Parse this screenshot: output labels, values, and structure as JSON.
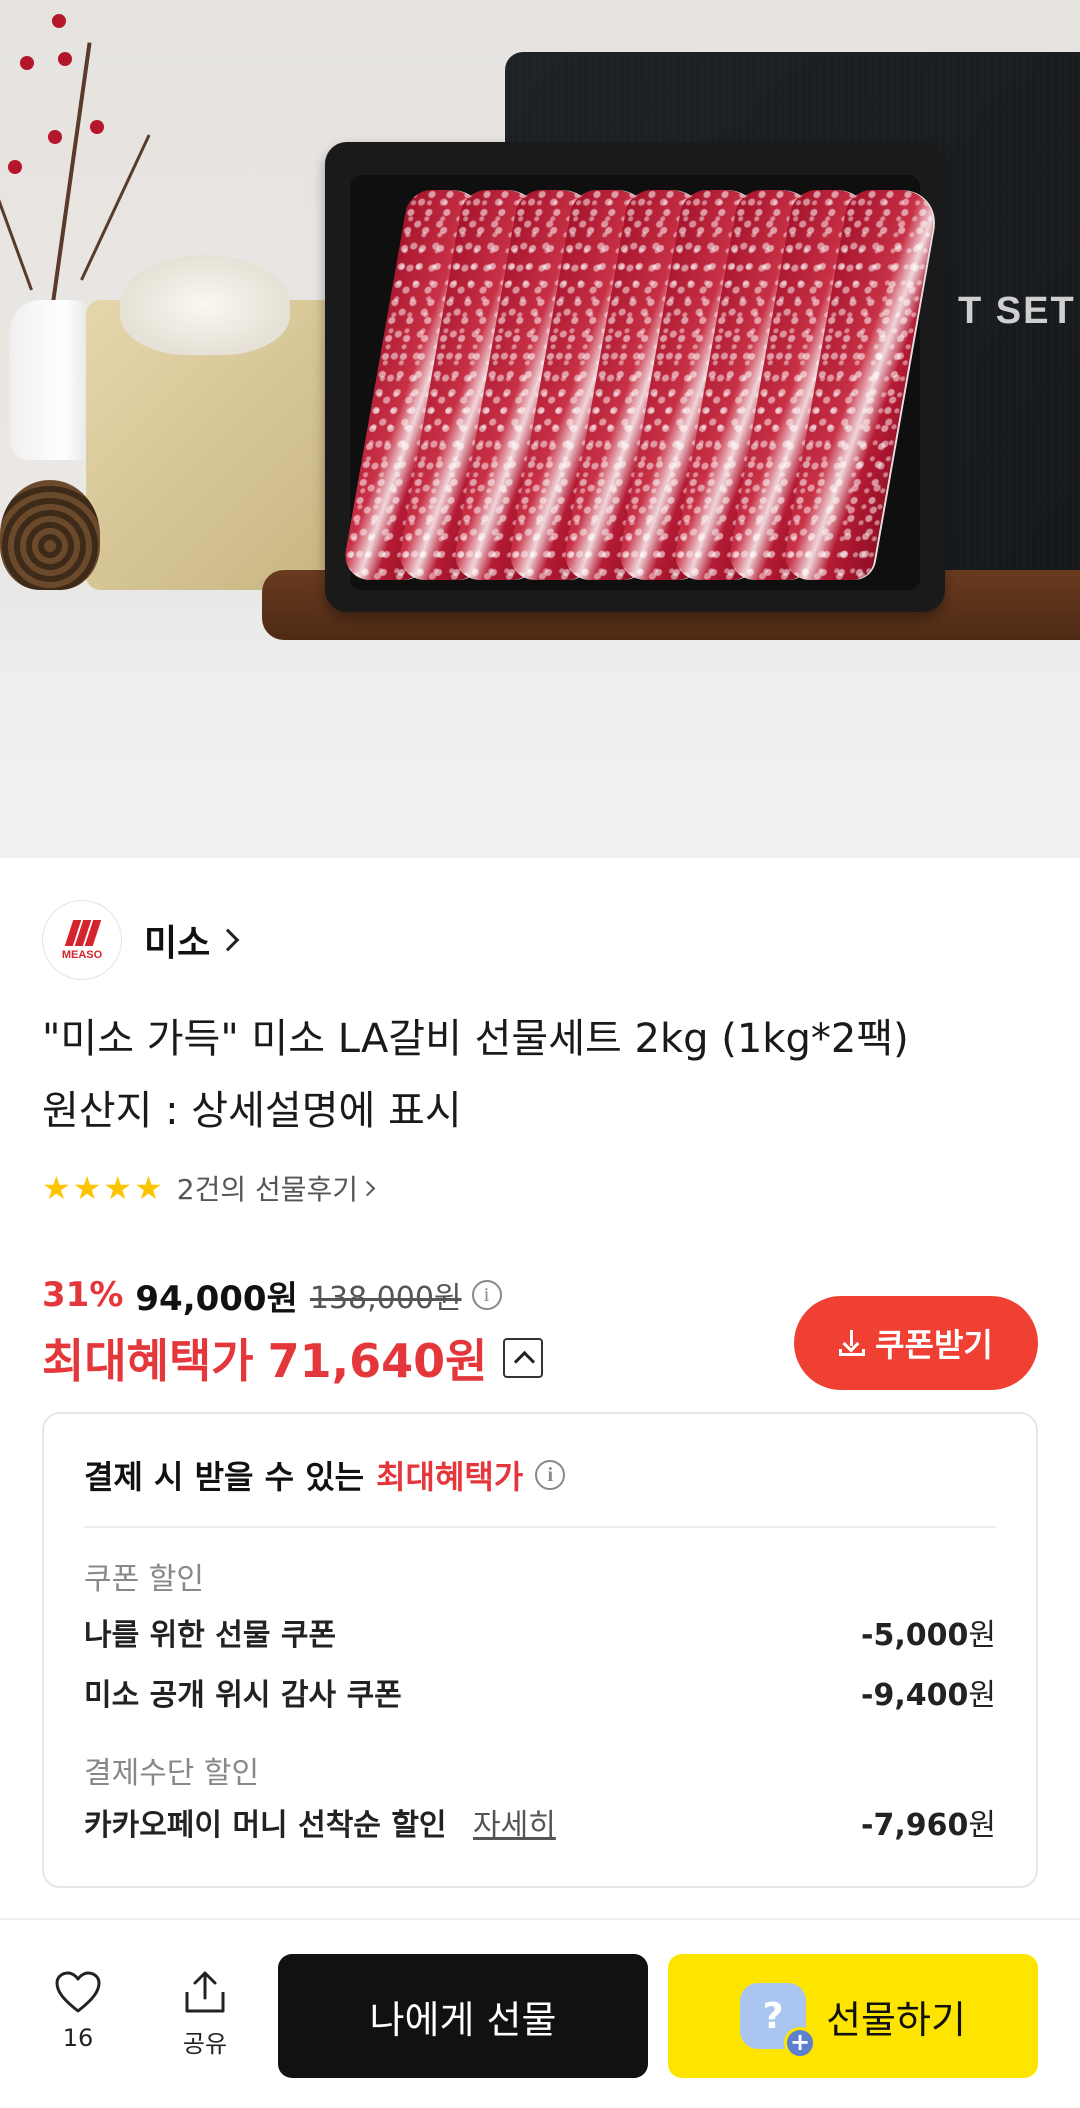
{
  "hero": {
    "box_text": "T SET"
  },
  "seller": {
    "logo_text": "MEASO",
    "name": "미소"
  },
  "product": {
    "title_line1": "\"미소 가득\" 미소 LA갈비 선물세트 2kg (1kg*2팩)",
    "title_line2": "원산지 : 상세설명에 표시",
    "rating_stars": 4,
    "review_link": "2건의 선물후기"
  },
  "price": {
    "discount_rate": "31%",
    "sale_price": "94,000원",
    "original_price": "138,000원",
    "best_label": "최대혜택가",
    "best_price": "71,640원",
    "coupon_button": "쿠폰받기"
  },
  "benefit": {
    "heading_prefix": "결제 시 받을 수 있는",
    "heading_highlight": "최대혜택가",
    "coupon_section": "쿠폰 할인",
    "coupons": [
      {
        "name": "나를 위한 선물 쿠폰",
        "amount": "-5,000",
        "unit": "원"
      },
      {
        "name": "미소 공개 위시 감사 쿠폰",
        "amount": "-9,400",
        "unit": "원"
      }
    ],
    "payment_section": "결제수단 할인",
    "payment": {
      "name": "카카오페이 머니 선착순 할인",
      "link": "자세히",
      "amount": "-7,960",
      "unit": "원"
    }
  },
  "bottom_bar": {
    "like_count": "16",
    "share_label": "공유",
    "gift_self": "나에게 선물",
    "gift": "선물하기"
  },
  "colors": {
    "accent_red": "#ef4033",
    "kakao_yellow": "#fee500",
    "star": "#ffc400"
  }
}
